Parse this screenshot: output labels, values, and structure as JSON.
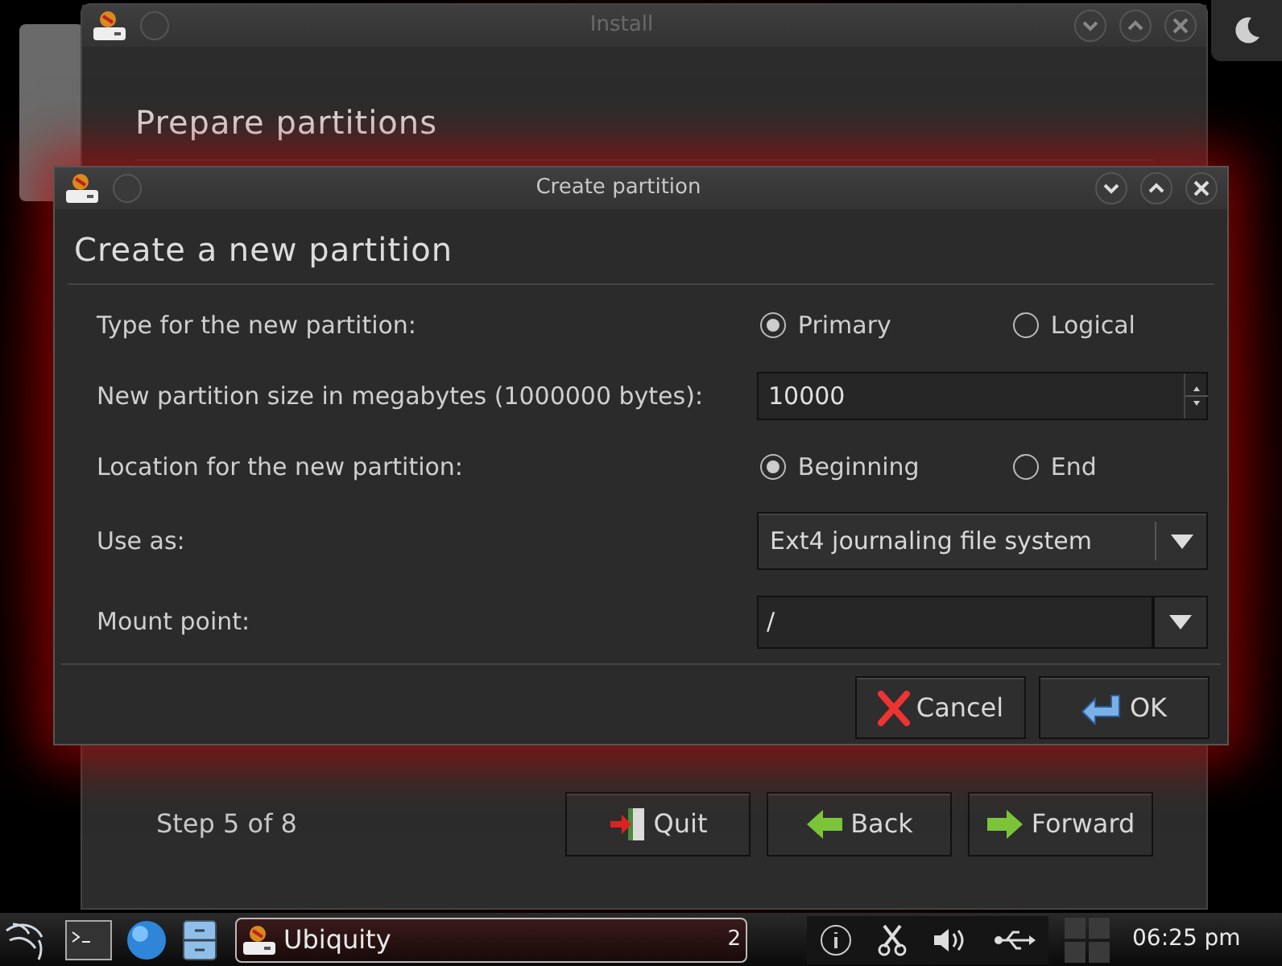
{
  "install_window": {
    "title": "Install",
    "heading": "Prepare partitions",
    "step": "Step 5 of 8",
    "buttons": [
      {
        "label": "Quit",
        "kind": "quit"
      },
      {
        "label": "Back",
        "kind": "back"
      },
      {
        "label": "Forward",
        "kind": "forward"
      }
    ]
  },
  "dialog": {
    "title": "Create partition",
    "heading": "Create a new partition",
    "rows": [
      {
        "kind": "radio",
        "label": "Type for the new partition:",
        "options": [
          {
            "label": "Primary",
            "selected": true
          },
          {
            "label": "Logical",
            "selected": false
          }
        ]
      },
      {
        "kind": "spin",
        "label": "New partition size in megabytes (1000000 bytes):",
        "value": "10000"
      },
      {
        "kind": "radio",
        "label": "Location for the new partition:",
        "options": [
          {
            "label": "Beginning",
            "selected": true
          },
          {
            "label": "End",
            "selected": false
          }
        ]
      },
      {
        "kind": "combo",
        "label": "Use as:",
        "value": "Ext4 journaling file system"
      },
      {
        "kind": "combo_entry",
        "label": "Mount point:",
        "value": "/"
      }
    ],
    "buttons": [
      {
        "label": "Cancel",
        "kind": "cancel"
      },
      {
        "label": "OK",
        "kind": "ok"
      }
    ]
  },
  "taskbar": {
    "task": {
      "label": "Ubiquity",
      "count": "2"
    },
    "clock": "06:25 pm"
  }
}
